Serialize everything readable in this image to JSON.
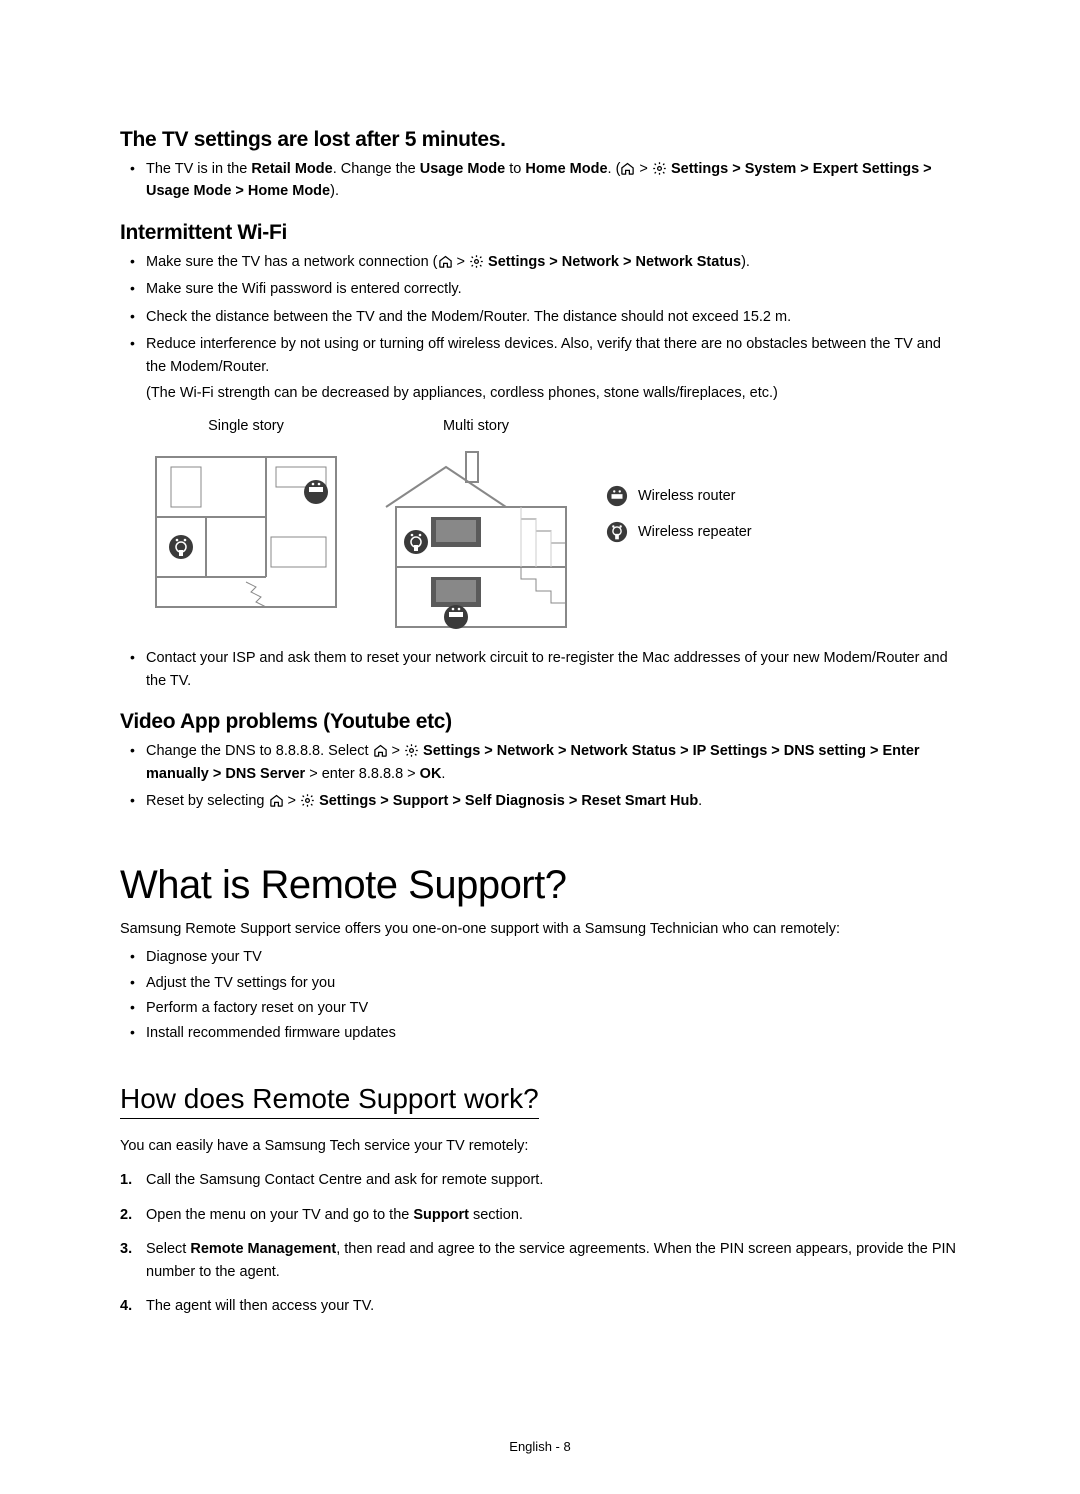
{
  "section1": {
    "heading": "The TV settings are lost after 5 minutes.",
    "bullet1_pre": "The TV is in the ",
    "bullet1_b1": "Retail Mode",
    "bullet1_mid1": ". Change the ",
    "bullet1_b2": "Usage Mode",
    "bullet1_mid2": " to ",
    "bullet1_b3": "Home Mode",
    "bullet1_mid3": ". (",
    "bullet1_chain1": " > ",
    "bullet1_path": " Settings > System > Expert Settings > Usage Mode > Home Mode",
    "bullet1_end": ")."
  },
  "section2": {
    "heading": "Intermittent Wi-Fi",
    "b1_pre": "Make sure the TV has a network connection (",
    "b1_chain": " > ",
    "b1_path": " Settings > Network > Network Status",
    "b1_end": ").",
    "b2": "Make sure the Wifi password is entered correctly.",
    "b3": "Check the distance between the TV and the Modem/Router. The distance should not exceed 15.2 m.",
    "b4": "Reduce interference by not using or turning off wireless devices. Also, verify that there are no obstacles between the TV and the Modem/Router.",
    "b4_sub": "(The Wi-Fi strength can be decreased by appliances, cordless phones, stone walls/fireplaces, etc.)",
    "diagram_label_single": "Single story",
    "diagram_label_multi": "Multi story",
    "legend_router": "Wireless router",
    "legend_repeater": "Wireless repeater",
    "b5": "Contact your ISP and ask them to reset your network circuit to re-register the Mac addresses of your new Modem/Router and the TV."
  },
  "section3": {
    "heading": "Video App problems (Youtube etc)",
    "b1_pre": "Change the DNS to 8.8.8.8. Select ",
    "b1_chain": " > ",
    "b1_path": " Settings > Network > Network Status > IP Settings > DNS setting > Enter manually > DNS Server",
    "b1_mid": " > enter 8.8.8.8 > ",
    "b1_ok": "OK",
    "b1_end": ".",
    "b2_pre": "Reset by selecting ",
    "b2_chain": " > ",
    "b2_path": " Settings > Support > Self Diagnosis > Reset Smart Hub",
    "b2_end": "."
  },
  "section4": {
    "heading": "What is Remote Support?",
    "intro": "Samsung Remote Support service offers you one-on-one support with a Samsung Technician who can remotely:",
    "items": [
      "Diagnose your TV",
      "Adjust the TV settings for you",
      "Perform a factory reset on your TV",
      "Install recommended firmware updates"
    ]
  },
  "section5": {
    "heading": "How does Remote Support work?",
    "intro": "You can easily have a Samsung Tech service your TV remotely:",
    "steps": {
      "s1": "Call the Samsung Contact Centre and ask for remote support.",
      "s2_pre": "Open the menu on your TV and go to the ",
      "s2_b": "Support",
      "s2_end": " section.",
      "s3_pre": "Select ",
      "s3_b": "Remote Management",
      "s3_end": ", then read and agree to the service agreements. When the PIN screen appears, provide the PIN number to the agent.",
      "s4": "The agent will then access your TV."
    }
  },
  "footer": "English - 8"
}
